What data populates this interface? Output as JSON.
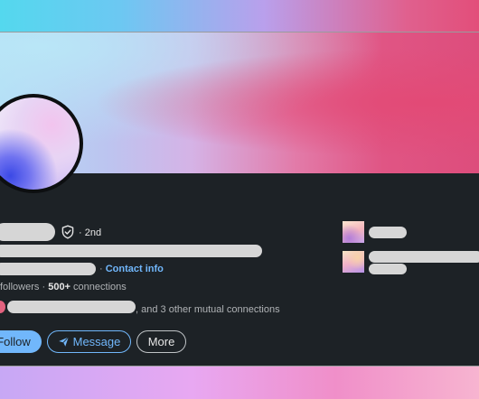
{
  "profile": {
    "degree_label": "· 2nd",
    "contact_sep": "·",
    "contact_label": "Contact info",
    "followers_suffix": "followers",
    "connections_sep": "·",
    "connections_count": "500+",
    "connections_label": "connections",
    "mutual_text": ", and 3 other mutual connections"
  },
  "actions": {
    "follow_label": "Follow",
    "message_label": "Message",
    "more_label": "More"
  },
  "icons": {
    "verified": "shield-check-icon",
    "message": "paper-plane-icon"
  },
  "colors": {
    "accent": "#71b7fb",
    "card_bg": "#1d2226",
    "placeholder": "#d6d6d6"
  }
}
